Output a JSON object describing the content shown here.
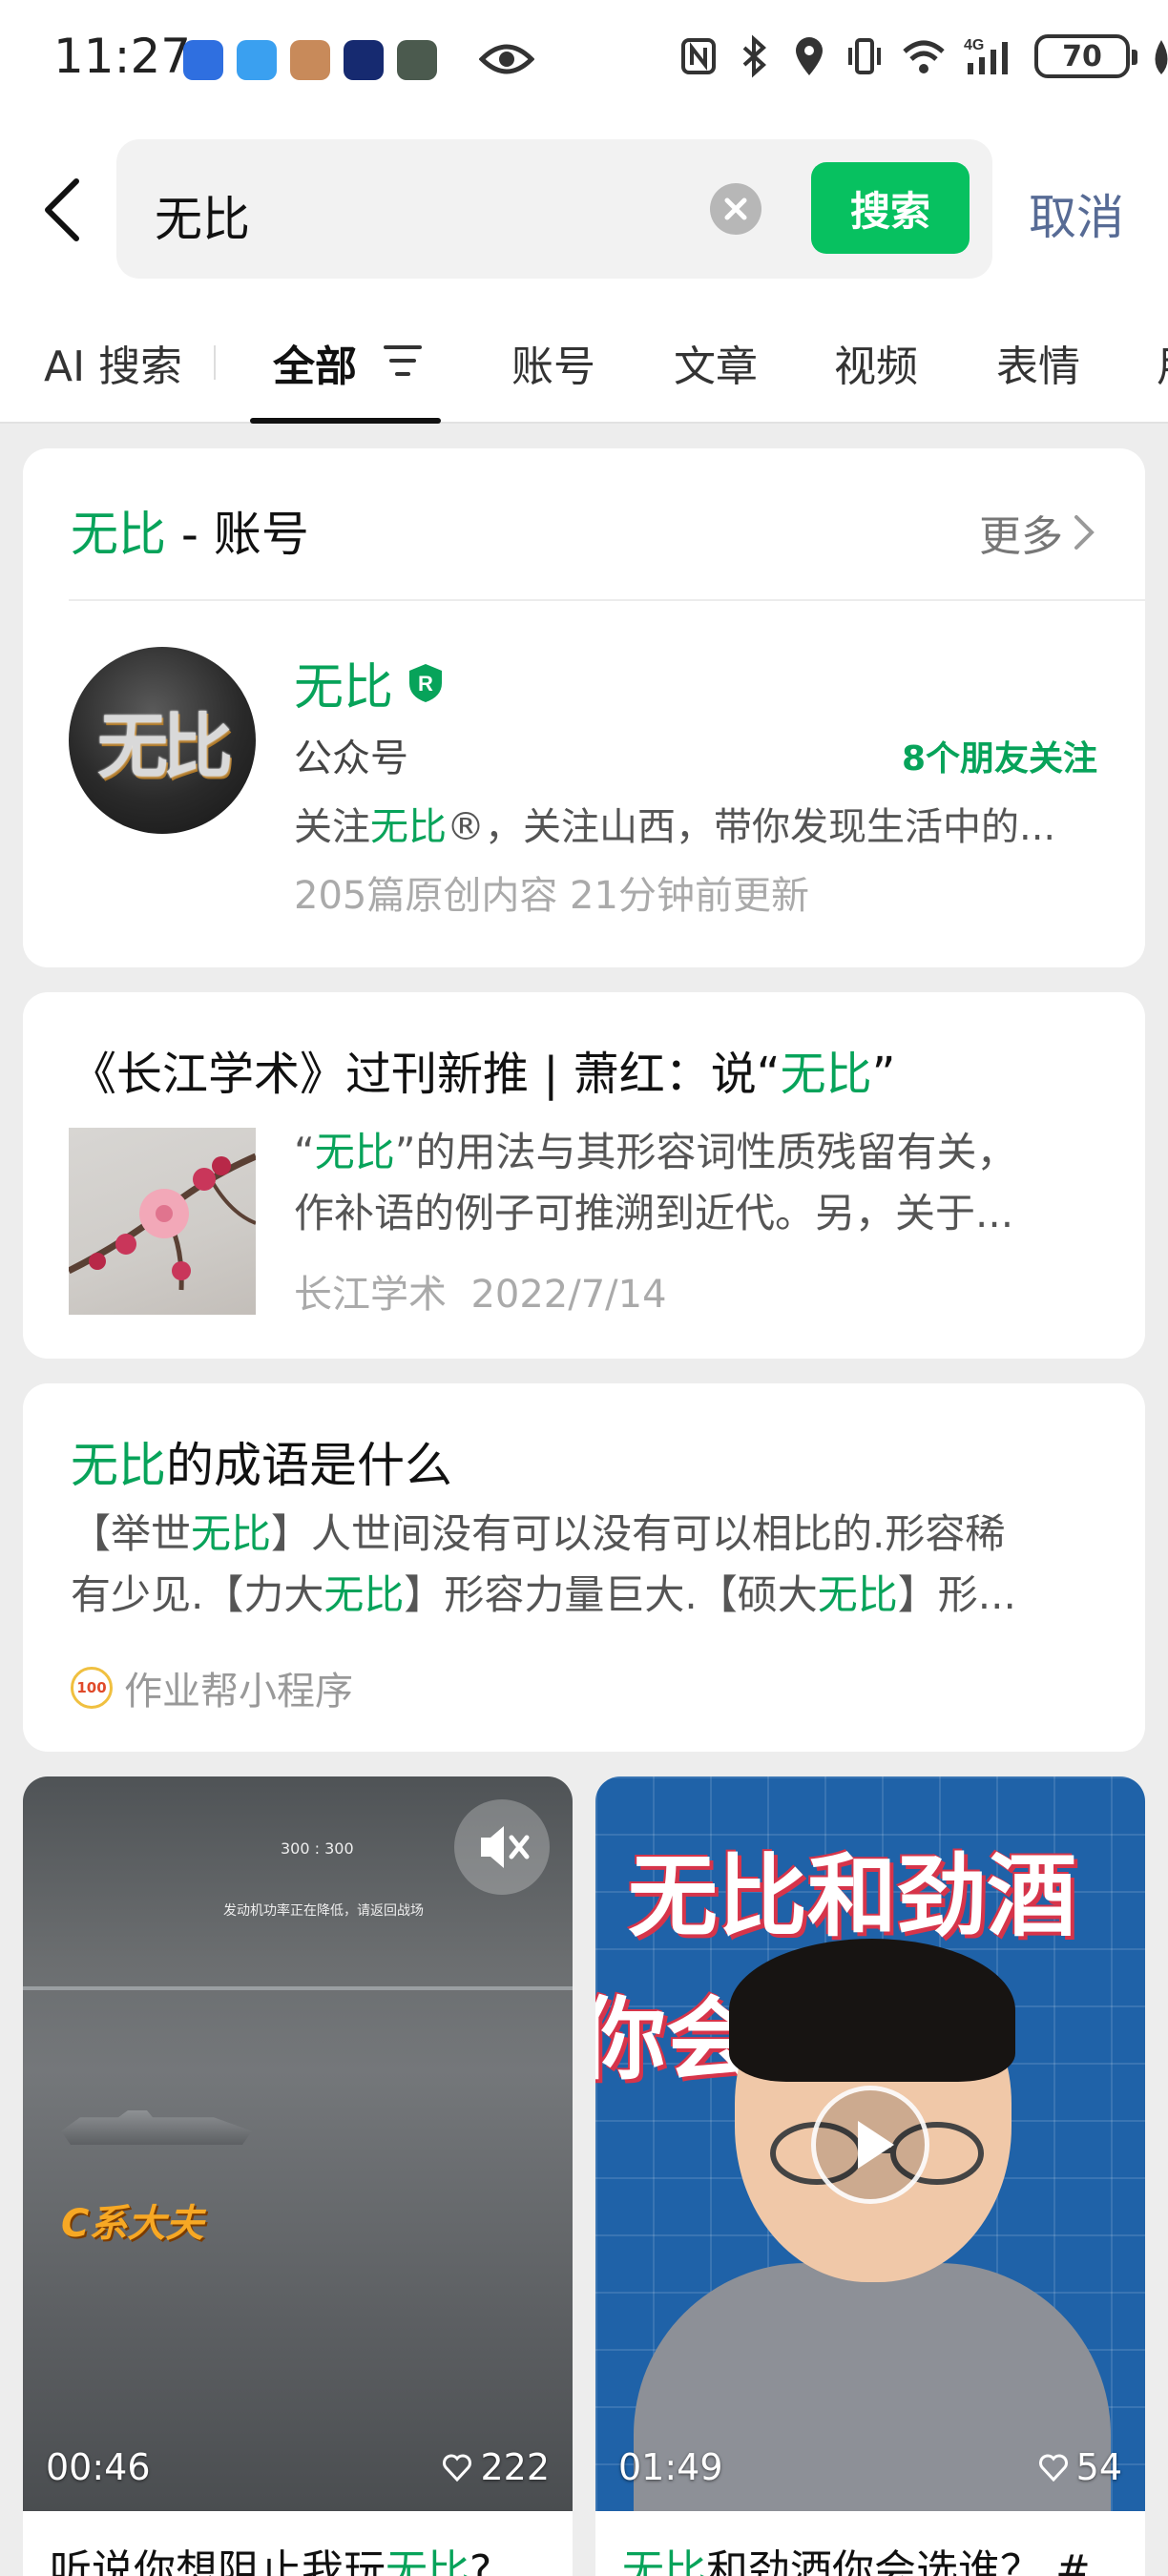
{
  "status_bar": {
    "time": "11:27",
    "battery": "70",
    "icons": [
      "app-icon-blue",
      "app-icon-weather",
      "app-icon-photo",
      "app-icon-dark",
      "app-icon-car",
      "eye-icon",
      "nfc-icon",
      "bluetooth-icon",
      "location-icon",
      "vibrate-icon",
      "wifi-icon",
      "signal-4g-icon",
      "battery-icon",
      "leaf-icon"
    ]
  },
  "search": {
    "query": "无比",
    "button_label": "搜索",
    "cancel_label": "取消"
  },
  "tabs": [
    {
      "label": "AI 搜索"
    },
    {
      "label": "全部",
      "active": true
    },
    {
      "label": "账号"
    },
    {
      "label": "文章"
    },
    {
      "label": "视频"
    },
    {
      "label": "表情"
    },
    {
      "label": "用"
    }
  ],
  "account_card": {
    "keyword": "无比",
    "section_label": " - 账号",
    "more_label": "更多",
    "avatar_text": "无比",
    "name": "无比",
    "type": "公众号",
    "friends_following": "8个朋友关注",
    "desc_prefix": "关注",
    "desc_keyword": "无比",
    "desc_suffix": "®，关注山西，带你发现生活中的...",
    "meta": "205篇原创内容  21分钟前更新"
  },
  "article_card": {
    "title_prefix": "《长江学术》过刊新推 | 萧红：说“",
    "title_keyword": "无比",
    "title_suffix": "”",
    "summary_line1_prefix": "“",
    "summary_line1_keyword": "无比",
    "summary_line1_suffix": "”的用法与其形容词性质残留有关，",
    "summary_line2": "作补语的例子可推溯到近代。另，关于...",
    "source": "长江学术",
    "date": "2022/7/14"
  },
  "idiom_card": {
    "title_keyword": "无比",
    "title_suffix": "的成语是什么",
    "line1_a": "【举世",
    "line1_kw": "无比",
    "line1_b": "】人世间没有可以没有可以相比的.形容稀",
    "line2_a": "有少见.【力大",
    "line2_kw1": "无比",
    "line2_b": "】形容力量巨大.【硕大",
    "line2_kw2": "无比",
    "line2_c": "】形...",
    "source_icon_text": "100",
    "source": "作业帮小程序"
  },
  "videos": [
    {
      "duration": "00:46",
      "likes": "222",
      "overlay_label": "C系大夫",
      "hud_score": "300 : 300",
      "hud_notice": "发动机功率正在降低，请返回战场",
      "caption_prefix": "听说你想阻止我玩",
      "caption_keyword": "无比",
      "caption_suffix": "?"
    },
    {
      "duration": "01:49",
      "likes": "54",
      "overlay_line1": "无比和劲酒",
      "overlay_line2": "你会  选谁",
      "caption_keyword": "无比",
      "caption_suffix": "和劲酒你会选谁？ #"
    }
  ],
  "colors": {
    "accent_green": "#07c160",
    "highlight_green": "#07a35a",
    "link_blue": "#576b95",
    "background": "#ededed"
  }
}
